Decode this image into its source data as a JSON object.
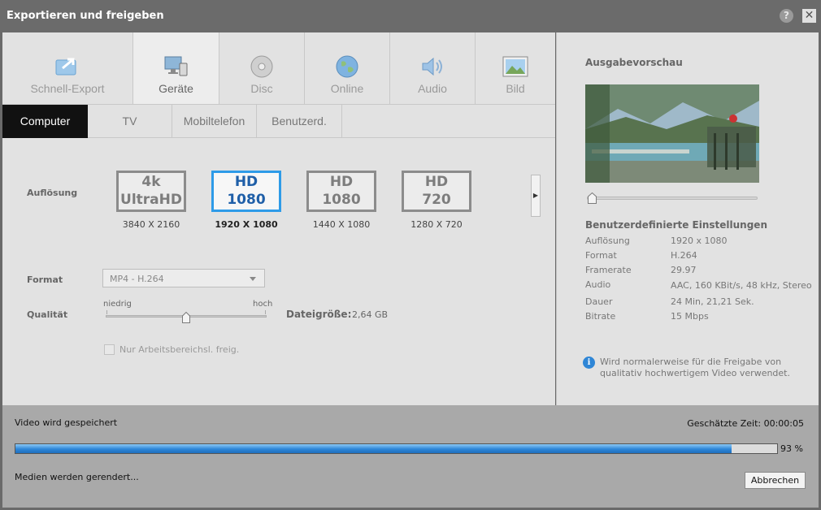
{
  "window": {
    "title": "Exportieren und freigeben",
    "help_label": "?",
    "close_label": "✕"
  },
  "tabs": [
    {
      "label": "Schnell-Export",
      "icon": "quick-export-icon"
    },
    {
      "label": "Geräte",
      "icon": "devices-icon",
      "active": true
    },
    {
      "label": "Disc",
      "icon": "disc-icon"
    },
    {
      "label": "Online",
      "icon": "globe-icon"
    },
    {
      "label": "Audio",
      "icon": "speaker-icon"
    },
    {
      "label": "Bild",
      "icon": "image-icon"
    }
  ],
  "subtabs": [
    {
      "label": "Computer",
      "active": true
    },
    {
      "label": "TV"
    },
    {
      "label": "Mobiltelefon"
    },
    {
      "label": "Benutzerd."
    }
  ],
  "resolution": {
    "label": "Auflösung",
    "options": [
      {
        "line1": "4k",
        "line2": "UltraHD",
        "caption": "3840 X 2160"
      },
      {
        "line1": "HD",
        "line2": "1080",
        "caption": "1920 X 1080",
        "selected": true
      },
      {
        "line1": "HD",
        "line2": "1080",
        "caption": "1440 X 1080"
      },
      {
        "line1": "HD",
        "line2": "720",
        "caption": "1280 X 720"
      }
    ]
  },
  "format": {
    "label": "Format",
    "value": "MP4 - H.264"
  },
  "quality": {
    "label": "Qualität",
    "low": "niedrig",
    "high": "hoch",
    "level": 0.5
  },
  "filesize": {
    "label": "Dateigröße:",
    "value": "2,64 GB"
  },
  "workarea_checkbox": {
    "label": "Nur Arbeitsbereichsl. freig.",
    "checked": false
  },
  "preview": {
    "title": "Ausgabevorschau",
    "settings_title": "Benutzerdefinierte Einstellungen",
    "specs": [
      {
        "key": "Auflösung",
        "value": "1920 x 1080"
      },
      {
        "key": "Format",
        "value": "H.264"
      },
      {
        "key": "Framerate",
        "value": "29.97"
      },
      {
        "key": "Audio",
        "value": "AAC, 160 KBit/s, 48 kHz, Stereo"
      },
      {
        "key": "Dauer",
        "value": "24 Min, 21,21 Sek."
      },
      {
        "key": "Bitrate",
        "value": "15 Mbps"
      }
    ],
    "info": "Wird normalerweise für die Freigabe von qualitativ hochwertigem Video verwendet.",
    "info_icon": "i"
  },
  "progress": {
    "status": "Video wird gespeichert",
    "estimate": "Geschätzte Zeit: 00:00:05",
    "percent_label": "93 %",
    "fraction": 0.94,
    "rendering": "Medien werden gerendert...",
    "cancel_label": "Abbrechen"
  },
  "colors": {
    "accent": "#2e9be8",
    "active_subtab": "#111111",
    "progress": "#2d86d8"
  }
}
